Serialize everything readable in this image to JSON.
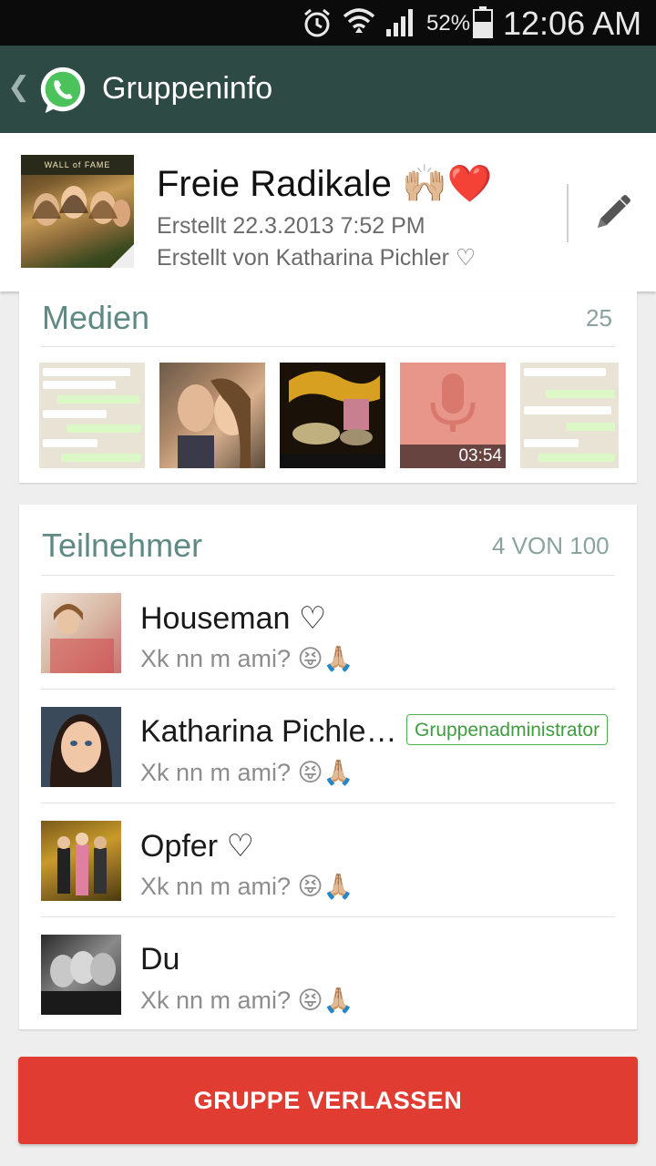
{
  "status_bar": {
    "battery_percent": "52%",
    "time": "12:06 AM",
    "icons": [
      "alarm-icon",
      "wifi-icon",
      "signal-icon",
      "battery-icon"
    ]
  },
  "action_bar": {
    "title": "Gruppeninfo",
    "back_icon": "chevron-left-icon",
    "logo": "whatsapp-logo-icon"
  },
  "group": {
    "name": "Freie Radikale 🙌🏼❤️",
    "created": "Erstellt 22.3.2013 7:52 PM",
    "created_by": "Erstellt von Katharina Pichler ♡",
    "photo_caption": "WALL of FAME",
    "edit_icon": "pencil-icon"
  },
  "media": {
    "title": "Medien",
    "count": "25",
    "audio_duration": "03:54"
  },
  "participants": {
    "title": "Teilnehmer",
    "count": "4 VON 100",
    "admin_label": "Gruppenadministrator",
    "members": [
      {
        "name": "Houseman ♡",
        "status": "Xk nn m ami? 😝🙏🏼",
        "admin": false
      },
      {
        "name": "Katharina Pichle…",
        "status": "Xk nn m ami? 😝🙏🏼",
        "admin": true
      },
      {
        "name": "Opfer ♡",
        "status": "Xk nn m ami? 😝🙏🏼",
        "admin": false
      },
      {
        "name": "Du",
        "status": "Xk nn m ami? 😝🙏🏼",
        "admin": false
      }
    ]
  },
  "leave_button": "GRUPPE VERLASSEN",
  "colors": {
    "action_bar": "#2e4a44",
    "accent": "#5f8a84",
    "leave": "#e03c31",
    "admin_green": "#4caf50"
  }
}
